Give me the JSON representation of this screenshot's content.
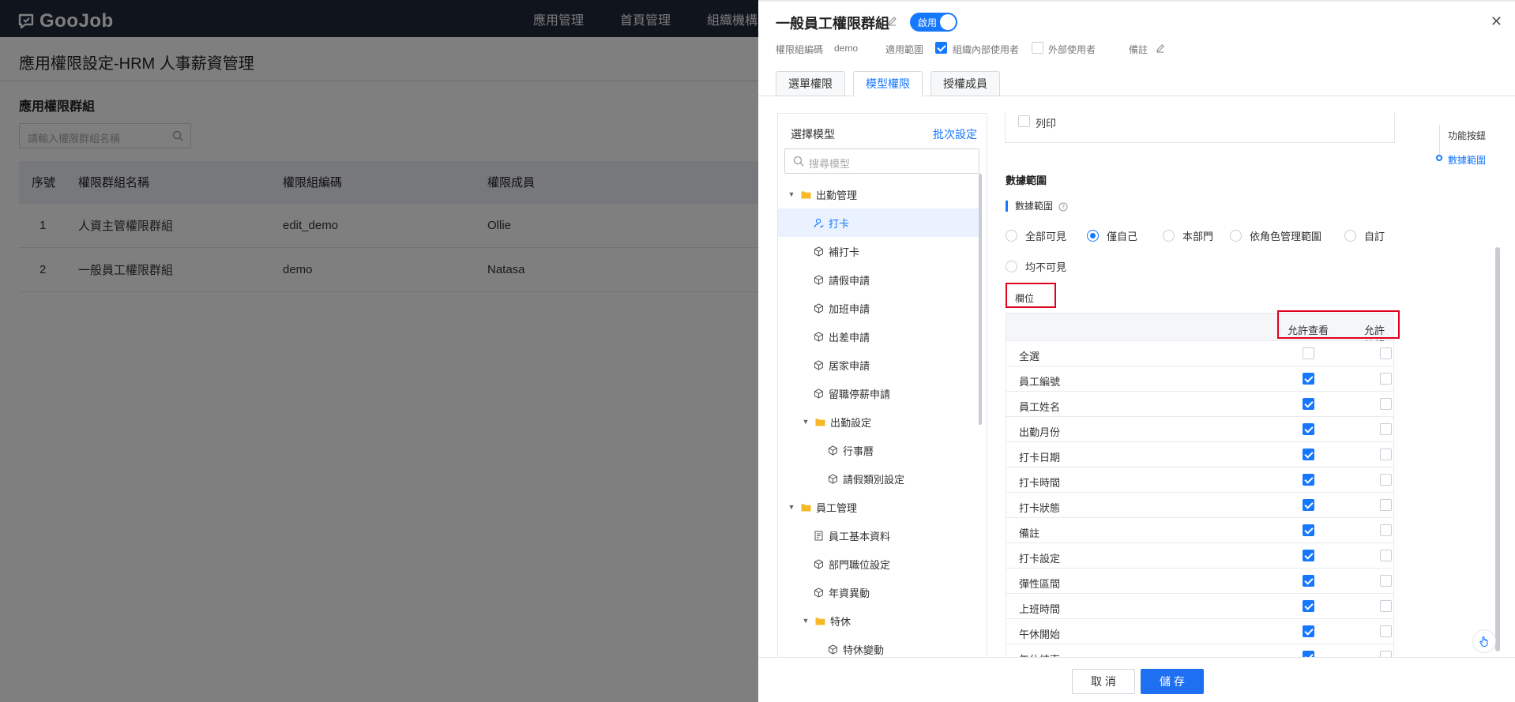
{
  "app": {
    "logo_text": "GooJob",
    "nav": [
      "應用管理",
      "首頁管理",
      "組織機構"
    ]
  },
  "page": {
    "title": "應用權限設定-HRM 人事薪資管理",
    "section_title": "應用權限群組",
    "search_placeholder": "請輸入權限群組名稱",
    "table": {
      "headers": [
        "序號",
        "權限群組名稱",
        "權限組編碼",
        "權限成員"
      ],
      "rows": [
        [
          "1",
          "人資主管權限群組",
          "edit_demo",
          "Ollie"
        ],
        [
          "2",
          "一般員工權限群組",
          "demo",
          "Natasa"
        ]
      ]
    }
  },
  "drawer": {
    "title": "一般員工權限群組",
    "status_label": "啟用",
    "meta": {
      "code_label": "權限組編碼",
      "code_value": "demo",
      "scope_label": "適用範圍",
      "internal_label": "組織內部使用者",
      "external_label": "外部使用者",
      "note_label": "備註"
    },
    "tabs": [
      "選單權限",
      "模型權限",
      "授權成員"
    ],
    "model_panel": {
      "title": "選擇模型",
      "batch_link": "批次設定",
      "search_placeholder": "搜尋模型",
      "tree": [
        {
          "label": "出勤管理",
          "type": "folder",
          "level": 0,
          "expanded": true
        },
        {
          "label": "打卡",
          "type": "person",
          "level": 1,
          "selected": true
        },
        {
          "label": "補打卡",
          "type": "model",
          "level": 1
        },
        {
          "label": "請假申請",
          "type": "model",
          "level": 1
        },
        {
          "label": "加班申請",
          "type": "model",
          "level": 1
        },
        {
          "label": "出差申請",
          "type": "model",
          "level": 1
        },
        {
          "label": "居家申請",
          "type": "model",
          "level": 1
        },
        {
          "label": "留職停薪申請",
          "type": "model",
          "level": 1
        },
        {
          "label": "出勤設定",
          "type": "folder",
          "level": 1,
          "expanded": true
        },
        {
          "label": "行事曆",
          "type": "model",
          "level": 2
        },
        {
          "label": "請假類別設定",
          "type": "model",
          "level": 2
        },
        {
          "label": "員工管理",
          "type": "folder",
          "level": 0,
          "expanded": true
        },
        {
          "label": "員工基本資料",
          "type": "form",
          "level": 1
        },
        {
          "label": "部門職位設定",
          "type": "model",
          "level": 1
        },
        {
          "label": "年資異動",
          "type": "model",
          "level": 1
        },
        {
          "label": "特休",
          "type": "folder",
          "level": 1,
          "expanded": true
        },
        {
          "label": "特休變動",
          "type": "model",
          "level": 2
        }
      ]
    },
    "print_label": "列印",
    "data_range": {
      "heading": "數據範圍",
      "sub_heading": "數據範圍",
      "options": [
        "全部可見",
        "僅自己",
        "本部門",
        "依角色管理範圍",
        "自訂",
        "均不可見"
      ],
      "selected": "僅自己"
    },
    "fields": {
      "label": "欄位",
      "col_view": "允許查看",
      "col_edit": "允許編輯",
      "rows": [
        {
          "name": "全選",
          "view": false,
          "edit": false
        },
        {
          "name": "員工編號",
          "view": true,
          "edit": false
        },
        {
          "name": "員工姓名",
          "view": true,
          "edit": false
        },
        {
          "name": "出勤月份",
          "view": true,
          "edit": false
        },
        {
          "name": "打卡日期",
          "view": true,
          "edit": false
        },
        {
          "name": "打卡時間",
          "view": true,
          "edit": false
        },
        {
          "name": "打卡狀態",
          "view": true,
          "edit": false
        },
        {
          "name": "備註",
          "view": true,
          "edit": false
        },
        {
          "name": "打卡設定",
          "view": true,
          "edit": false
        },
        {
          "name": "彈性區間",
          "view": true,
          "edit": false
        },
        {
          "name": "上班時間",
          "view": true,
          "edit": false
        },
        {
          "name": "午休開始",
          "view": true,
          "edit": false
        },
        {
          "name": "午休結束",
          "view": true,
          "edit": false
        }
      ]
    },
    "anchors": [
      "功能按鈕",
      "數據範圍"
    ],
    "footer": {
      "cancel": "取 消",
      "save": "儲 存"
    }
  },
  "colors": {
    "primary": "#1677ff",
    "topbar": "#20283a",
    "highlight_border": "#e0001b"
  }
}
